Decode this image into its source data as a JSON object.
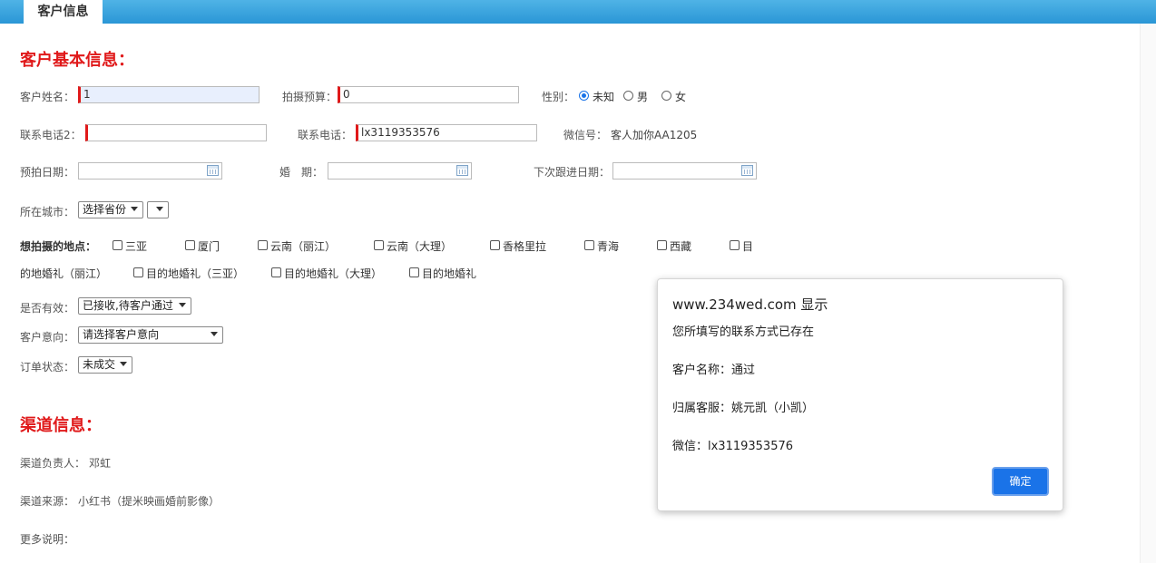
{
  "header": {
    "tab_label": "客户信息"
  },
  "basic": {
    "section_title": "客户基本信息：",
    "name_label": "客户姓名：",
    "name_value": "1",
    "budget_label": "拍摄预算：",
    "budget_value": "0",
    "gender_label": "性别：",
    "gender_options": [
      "未知",
      "男",
      "女"
    ],
    "gender_selected": "未知",
    "phone2_label": "联系电话2：",
    "phone2_value": "",
    "phone_label": "联系电话：",
    "phone_value": "lx3119353576",
    "wechat_label": "微信号：",
    "wechat_value": "客人加你AA1205",
    "shoot_date_label": "预拍日期：",
    "wedding_date_label": "婚　期：",
    "followup_label": "下次跟进日期：",
    "city_label": "所在城市：",
    "province_select": "选择省份",
    "locations_label": "想拍摄的地点：",
    "locations_row1": [
      "三亚",
      "厦门",
      "云南（丽江）",
      "云南（大理）",
      "香格里拉",
      "青海",
      "西藏",
      "目"
    ],
    "locations_row2_lead": "的地婚礼（丽江）",
    "locations_row2": [
      "目的地婚礼（三亚）",
      "目的地婚礼（大理）",
      "目的地婚礼"
    ],
    "valid_label": "是否有效：",
    "valid_select": "已接收,待客户通过",
    "intent_label": "客户意向：",
    "intent_select": "请选择客户意向",
    "order_label": "订单状态：",
    "order_select": "未成交"
  },
  "channel": {
    "section_title": "渠道信息：",
    "owner_label": "渠道负责人：",
    "owner_value": "邓虹",
    "source_label": "渠道来源：",
    "source_value": "小红书（提米映画婚前影像）",
    "notes_label": "更多说明："
  },
  "dialog": {
    "title": "www.234wed.com 显示",
    "line1": "您所填写的联系方式已存在",
    "line2": "客户名称：通过",
    "line3": "归属客服：姚元凯（小凯）",
    "line4": "微信：lx3119353576",
    "ok_label": "确定"
  },
  "colors": {
    "accent_red": "#e0191a",
    "header_blue": "#2a96d6",
    "button_blue": "#1a73e8"
  }
}
